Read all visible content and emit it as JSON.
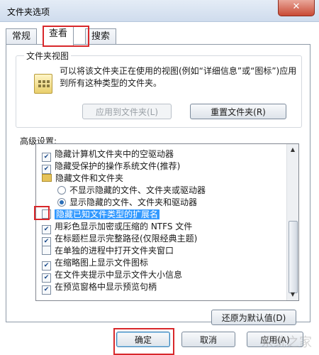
{
  "window": {
    "title": "文件夹选项",
    "close_symbol": "✕"
  },
  "tabs": [
    "常规",
    "查看",
    "搜索"
  ],
  "folder_views": {
    "heading": "文件夹视图",
    "description": "可以将该文件夹正在使用的视图(例如“详细信息”或“图标”)应用到所有这种类型的文件夹。",
    "apply_button": "应用到文件夹(L)",
    "reset_button": "重置文件夹(R)"
  },
  "advanced": {
    "heading": "高级设置:",
    "items": [
      {
        "type": "checkbox",
        "checked": true,
        "label": "隐藏计算机文件夹中的空驱动器"
      },
      {
        "type": "checkbox",
        "checked": true,
        "label": "隐藏受保护的操作系统文件(推荐)"
      },
      {
        "type": "folder",
        "label": "隐藏文件和文件夹"
      },
      {
        "type": "radio",
        "checked": false,
        "label": "不显示隐藏的文件、文件夹或驱动器"
      },
      {
        "type": "radio",
        "checked": true,
        "label": "显示隐藏的文件、文件夹和驱动器"
      },
      {
        "type": "checkbox",
        "checked": false,
        "selected": true,
        "label": "隐藏已知文件类型的扩展名"
      },
      {
        "type": "checkbox",
        "checked": true,
        "label": "用彩色显示加密或压缩的 NTFS 文件"
      },
      {
        "type": "checkbox",
        "checked": true,
        "label": "在标题栏显示完整路径(仅限经典主题)"
      },
      {
        "type": "checkbox",
        "checked": false,
        "label": "在单独的进程中打开文件夹窗口"
      },
      {
        "type": "checkbox",
        "checked": true,
        "label": "在缩略图上显示文件图标"
      },
      {
        "type": "checkbox",
        "checked": true,
        "label": "在文件夹提示中显示文件大小信息"
      },
      {
        "type": "checkbox",
        "checked": true,
        "label": "在预览窗格中显示预览句柄"
      }
    ],
    "restore_button": "还原为默认值(D)"
  },
  "footer": {
    "ok": "确定",
    "cancel": "取消",
    "apply": "应用(A)"
  },
  "watermark": "系统之家",
  "highlight_color": "#d8282b"
}
